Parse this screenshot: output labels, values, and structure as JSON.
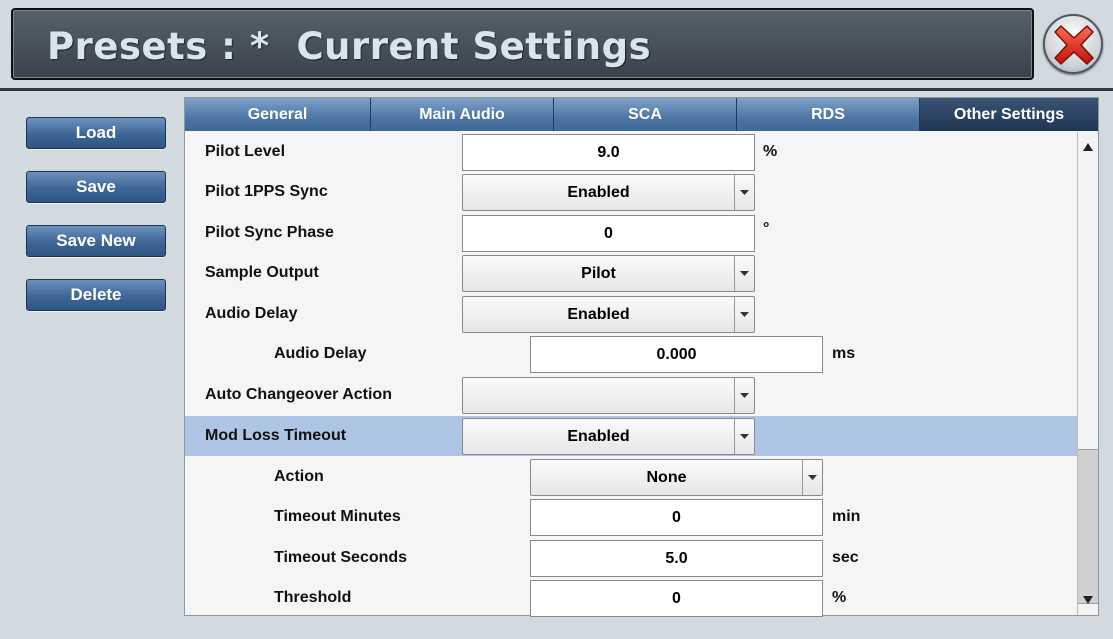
{
  "header": {
    "title": "Presets : *  Current Settings",
    "close_icon": "close-x-icon"
  },
  "sidebar": {
    "buttons": [
      {
        "label": "Load"
      },
      {
        "label": "Save"
      },
      {
        "label": "Save New"
      },
      {
        "label": "Delete"
      }
    ]
  },
  "tabs": [
    {
      "label": "General",
      "active": false
    },
    {
      "label": "Main Audio",
      "active": false
    },
    {
      "label": "SCA",
      "active": false
    },
    {
      "label": "RDS",
      "active": false
    },
    {
      "label": "Other Settings",
      "active": true
    }
  ],
  "rows": [
    {
      "label": "Pilot Level",
      "type": "input",
      "value": "9.0",
      "unit": "%"
    },
    {
      "label": "Pilot 1PPS Sync",
      "type": "select",
      "value": "Enabled"
    },
    {
      "label": "Pilot Sync Phase",
      "type": "input",
      "value": "0",
      "unit": "°"
    },
    {
      "label": "Sample Output",
      "type": "select",
      "value": "Pilot"
    },
    {
      "label": "Audio Delay",
      "type": "select",
      "value": "Enabled"
    },
    {
      "label": "Audio Delay",
      "type": "input",
      "value": "0.000",
      "unit": "ms"
    },
    {
      "label": "Auto Changeover Action",
      "type": "select",
      "value": ""
    },
    {
      "label": "Mod Loss Timeout",
      "type": "select",
      "value": "Enabled"
    },
    {
      "label": "Action",
      "type": "select",
      "value": "None"
    },
    {
      "label": "Timeout Minutes",
      "type": "input",
      "value": "0",
      "unit": "min"
    },
    {
      "label": "Timeout Seconds",
      "type": "input",
      "value": "5.0",
      "unit": "sec"
    },
    {
      "label": "Threshold",
      "type": "input",
      "value": "0",
      "unit": "%"
    }
  ],
  "colors": {
    "tab": "#4d76a5",
    "tab_active": "#1f3654",
    "highlight": "#aec5e6",
    "button": "#3d6697"
  }
}
